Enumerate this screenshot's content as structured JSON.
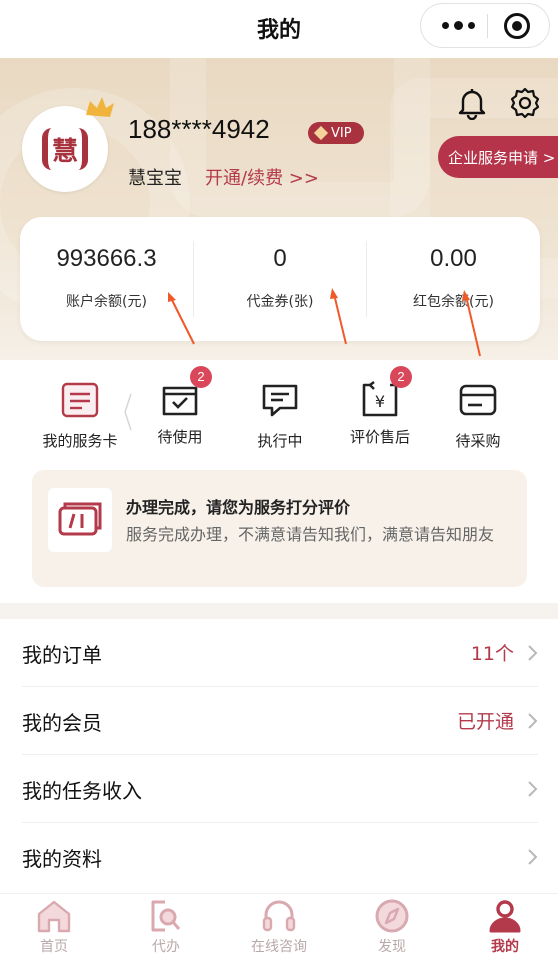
{
  "titlebar": {
    "title": "我的"
  },
  "profile": {
    "avatar_text": "慧",
    "phone": "188****4942",
    "vip_label": "VIP",
    "nickname": "慧宝宝",
    "renew_link": "开通/续费 >>",
    "enterprise_button": "企业服务申请 >"
  },
  "balance": {
    "items": [
      {
        "value": "993666.3",
        "label": "账户余额(元)"
      },
      {
        "value": "0",
        "label": "代金券(张)"
      },
      {
        "value": "0.00",
        "label": "红包余额(元)"
      }
    ]
  },
  "services": {
    "items": [
      {
        "label": "我的服务卡",
        "icon": "service-card-icon",
        "badge": ""
      },
      {
        "label": "待使用",
        "icon": "wallet-check-icon",
        "badge": "2"
      },
      {
        "label": "执行中",
        "icon": "message-icon",
        "badge": ""
      },
      {
        "label": "评价售后",
        "icon": "yuan-return-icon",
        "badge": "2"
      },
      {
        "label": "待采购",
        "icon": "card-icon",
        "badge": ""
      }
    ]
  },
  "notice": {
    "title": "办理完成，请您为服务打分评价",
    "description": "服务完成办理，不满意请告知我们，满意请告知朋友"
  },
  "menu": {
    "items": [
      {
        "label": "我的订单",
        "value": "11个"
      },
      {
        "label": "我的会员",
        "value": "已开通"
      },
      {
        "label": "我的任务收入",
        "value": ""
      },
      {
        "label": "我的资料",
        "value": ""
      }
    ]
  },
  "tabbar": {
    "items": [
      {
        "label": "首页",
        "icon": "home-icon"
      },
      {
        "label": "代办",
        "icon": "search-document-icon"
      },
      {
        "label": "在线咨询",
        "icon": "headset-icon"
      },
      {
        "label": "发现",
        "icon": "compass-icon"
      },
      {
        "label": "我的",
        "icon": "user-icon"
      }
    ],
    "active": "我的"
  },
  "colors": {
    "accent": "#b33a4a",
    "gold_bg": "#e9d9c2",
    "badge": "#d9475a",
    "annotation_arrow": "#f05a28"
  }
}
